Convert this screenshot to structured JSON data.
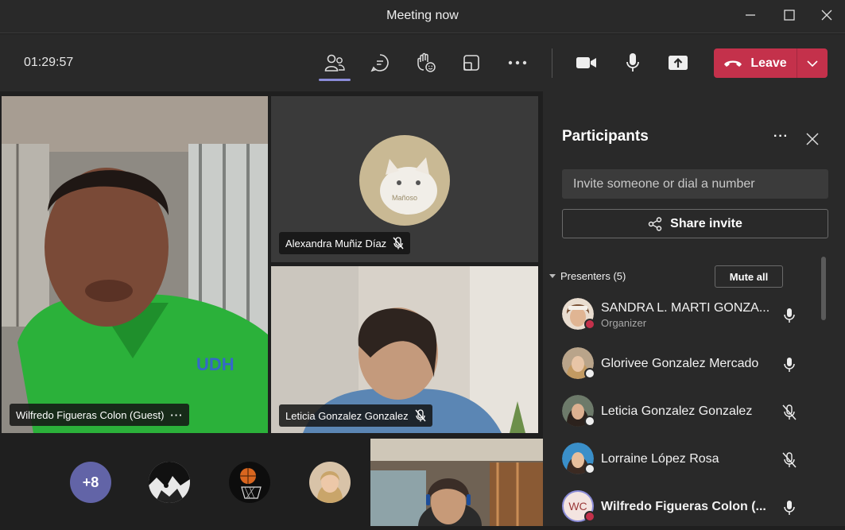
{
  "window": {
    "title": "Meeting now"
  },
  "toolbar": {
    "timer": "01:29:57",
    "leave_label": "Leave"
  },
  "tiles": [
    {
      "name": "Wilfredo Figueras Colon (Guest)",
      "more": "···"
    },
    {
      "name": "Alexandra Muñiz Díaz",
      "avatar_text": "Mañoso"
    },
    {
      "name": "Leticia Gonzalez Gonzalez"
    }
  ],
  "overflow": {
    "count": "+8"
  },
  "panel": {
    "title": "Participants",
    "more": "···",
    "invite_placeholder": "Invite someone or dial a number",
    "share_label": "Share invite",
    "section_label": "Presenters (5)",
    "mute_all": "Mute all",
    "participants": [
      {
        "name": "SANDRA L. MARTI GONZA...",
        "role": "Organizer",
        "mic": "on"
      },
      {
        "name": "Glorivee Gonzalez Mercado",
        "role": "",
        "mic": "on"
      },
      {
        "name": "Leticia Gonzalez Gonzalez",
        "role": "",
        "mic": "off"
      },
      {
        "name": "Lorraine López Rosa",
        "role": "",
        "mic": "off"
      },
      {
        "name": "Wilfredo Figueras Colon (...",
        "role": "",
        "mic": "on",
        "initials": "WC"
      }
    ]
  },
  "colors": {
    "accent": "#8b8cd8",
    "leave": "#c4314b",
    "panel": "#292929",
    "stage": "#1f1f1f"
  }
}
